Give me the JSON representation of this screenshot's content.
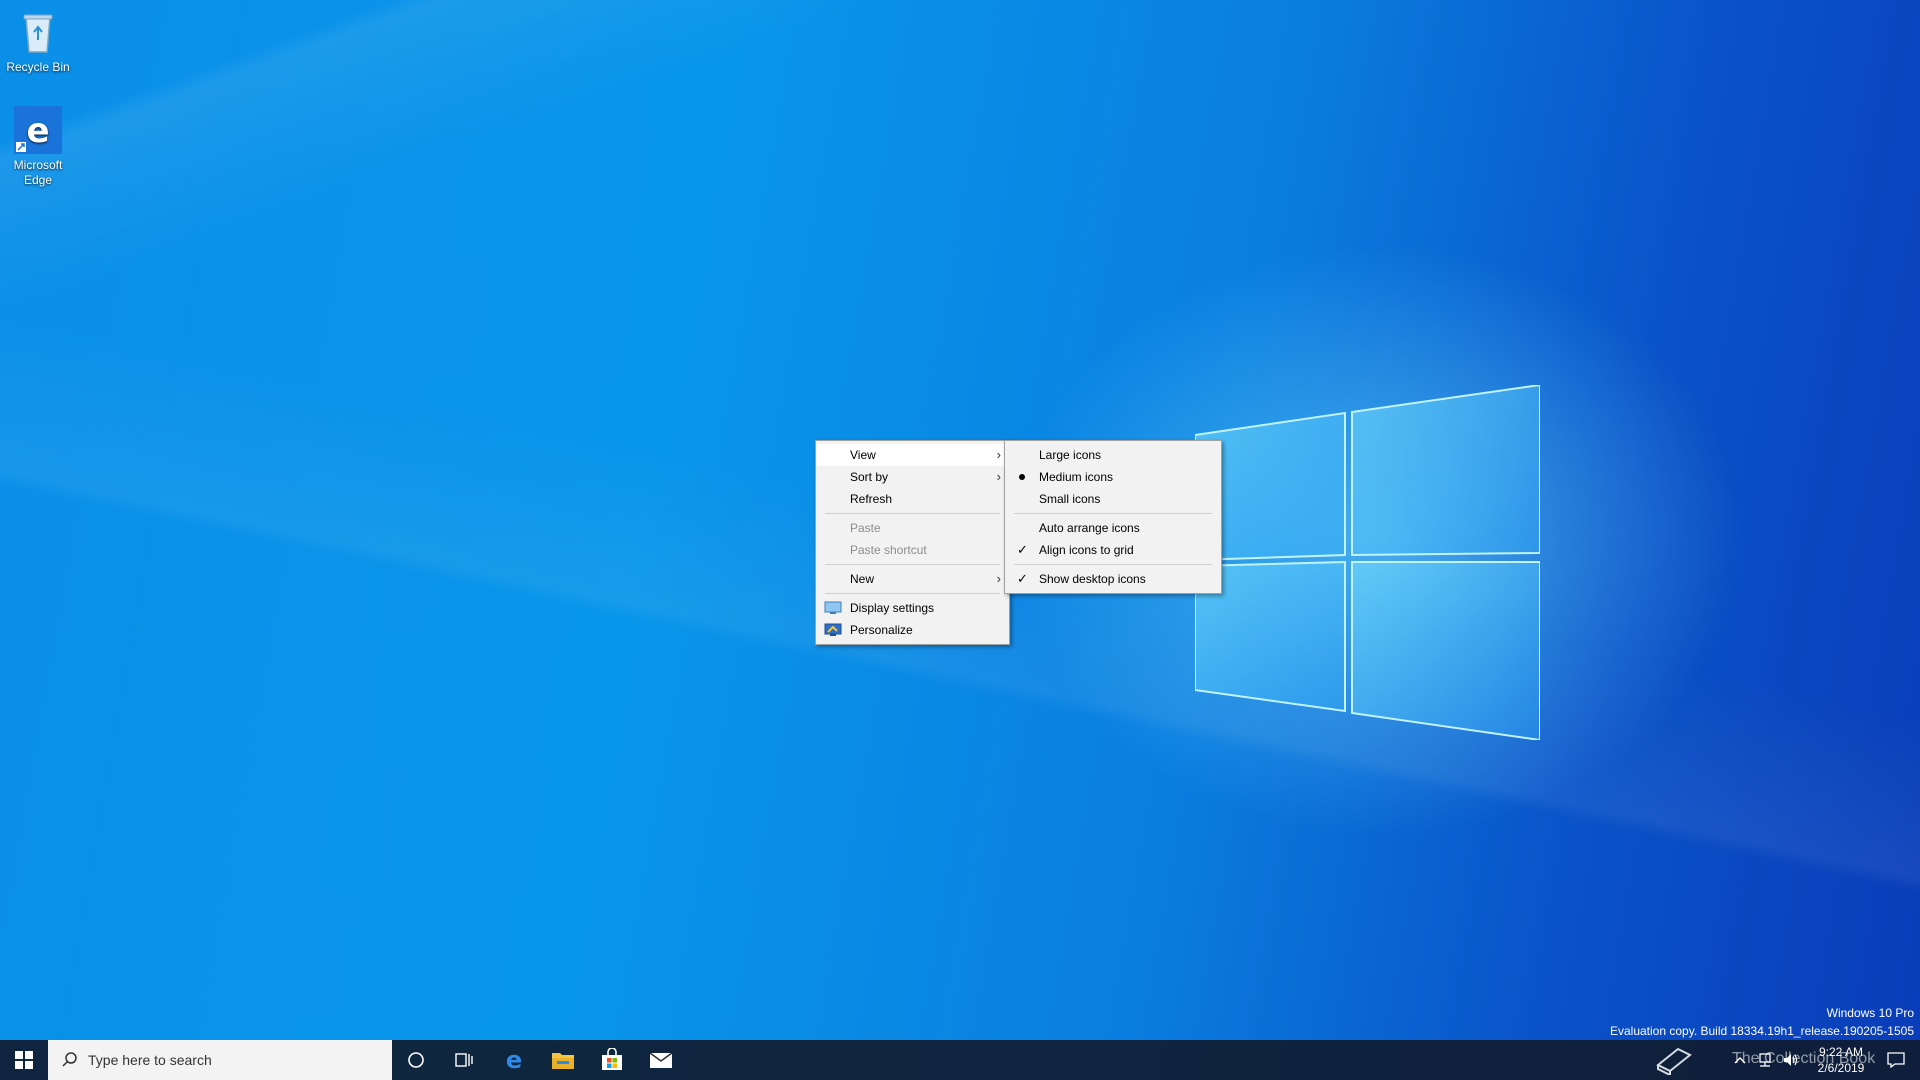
{
  "desktop": {
    "icons": [
      {
        "label": "Recycle Bin",
        "icon": "recycle-bin-icon"
      },
      {
        "label": "Microsoft Edge",
        "icon": "edge-icon"
      }
    ]
  },
  "context_menu": {
    "items": [
      {
        "label": "View",
        "has_submenu": true,
        "state": "highlighted"
      },
      {
        "label": "Sort by",
        "has_submenu": true
      },
      {
        "label": "Refresh"
      },
      {
        "label": "Paste",
        "disabled": true
      },
      {
        "label": "Paste shortcut",
        "disabled": true
      },
      {
        "label": "New",
        "has_submenu": true
      },
      {
        "label": "Display settings",
        "icon": "display-settings-icon"
      },
      {
        "label": "Personalize",
        "icon": "personalize-icon"
      }
    ]
  },
  "view_submenu": {
    "items": [
      {
        "label": "Large icons"
      },
      {
        "label": "Medium icons",
        "selected": true
      },
      {
        "label": "Small icons"
      },
      {
        "label": "Auto arrange icons"
      },
      {
        "label": "Align icons to grid",
        "checked": true
      },
      {
        "label": "Show desktop icons",
        "checked": true
      }
    ]
  },
  "taskbar": {
    "search_placeholder": "Type here to search",
    "pinned": [
      "cortana-icon",
      "task-view-icon",
      "edge-icon",
      "file-explorer-icon",
      "store-icon",
      "mail-icon"
    ],
    "clock_time": "9:22 AM",
    "clock_date": "2/6/2019"
  },
  "watermark": {
    "edition": "Windows 10 Pro",
    "build": "Evaluation copy. Build 18334.19h1_release.190205-1505",
    "overlay_text": "The Collection Book"
  },
  "colors": {
    "desktop_blue": "#0a8fe8",
    "menu_bg": "#f2f2f2",
    "taskbar_bg": "#101c30",
    "edge_blue": "#1a73d9"
  }
}
